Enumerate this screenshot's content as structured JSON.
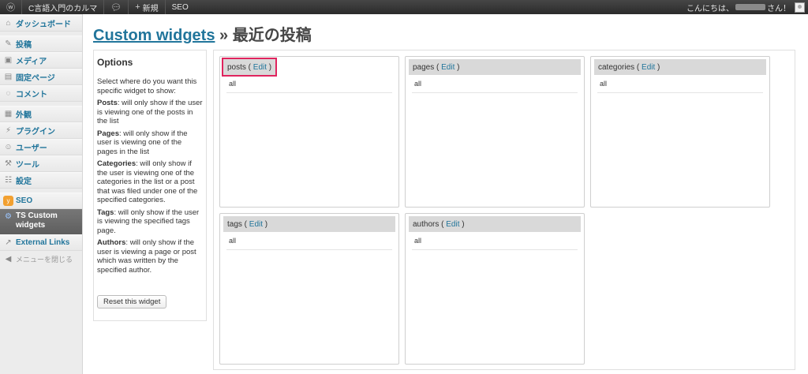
{
  "adminbar": {
    "site_name": "C言語入門のカルマ",
    "new_label": "新規",
    "seo_label": "SEO",
    "greeting": "こんにちは、",
    "greeting_suffix": "さん！"
  },
  "sidebar": {
    "items": [
      {
        "label": "ダッシュボード",
        "icon": "dashboard-icon"
      },
      {
        "label": "投稿",
        "icon": "pin-icon"
      },
      {
        "label": "メディア",
        "icon": "media-icon"
      },
      {
        "label": "固定ページ",
        "icon": "page-icon"
      },
      {
        "label": "コメント",
        "icon": "comment-icon"
      },
      {
        "label": "外観",
        "icon": "appearance-icon"
      },
      {
        "label": "プラグイン",
        "icon": "plugin-icon"
      },
      {
        "label": "ユーザー",
        "icon": "users-icon"
      },
      {
        "label": "ツール",
        "icon": "tools-icon"
      },
      {
        "label": "設定",
        "icon": "settings-icon"
      },
      {
        "label": "SEO",
        "icon": "seo-icon"
      },
      {
        "label": "TS Custom widgets",
        "icon": "gear-icon"
      },
      {
        "label": "External Links",
        "icon": "link-icon"
      },
      {
        "label": "メニューを閉じる",
        "icon": "collapse-icon"
      }
    ]
  },
  "page": {
    "title_link": "Custom widgets",
    "title_rest": "» 最近の投稿"
  },
  "options": {
    "heading": "Options",
    "intro": "Select where do you want this specific widget to show:",
    "posts_term": "Posts",
    "posts_desc": ": will only show if the user is viewing one of the posts in the list",
    "pages_term": "Pages",
    "pages_desc": ": will only show if the user is viewing one of the pages in the list",
    "categories_term": "Categories",
    "categories_desc": ": will only show if the user is viewing one of the categories in the list or a post that was filed under one of the specified categories.",
    "tags_term": "Tags",
    "tags_desc": ": will only show if the user is viewing the specified tags page.",
    "authors_term": "Authors",
    "authors_desc": ": will only show if the user is viewing a page or post which was written by the specified author.",
    "reset_label": "Reset this widget"
  },
  "panels": [
    {
      "name": "posts",
      "edit": "Edit",
      "value": "all"
    },
    {
      "name": "pages",
      "edit": "Edit",
      "value": "all"
    },
    {
      "name": "categories",
      "edit": "Edit",
      "value": "all"
    },
    {
      "name": "tags",
      "edit": "Edit",
      "value": "all"
    },
    {
      "name": "authors",
      "edit": "Edit",
      "value": "all"
    }
  ],
  "colors": {
    "link": "#21759b",
    "highlight": "#e0245e",
    "adminbar": "#464646"
  }
}
